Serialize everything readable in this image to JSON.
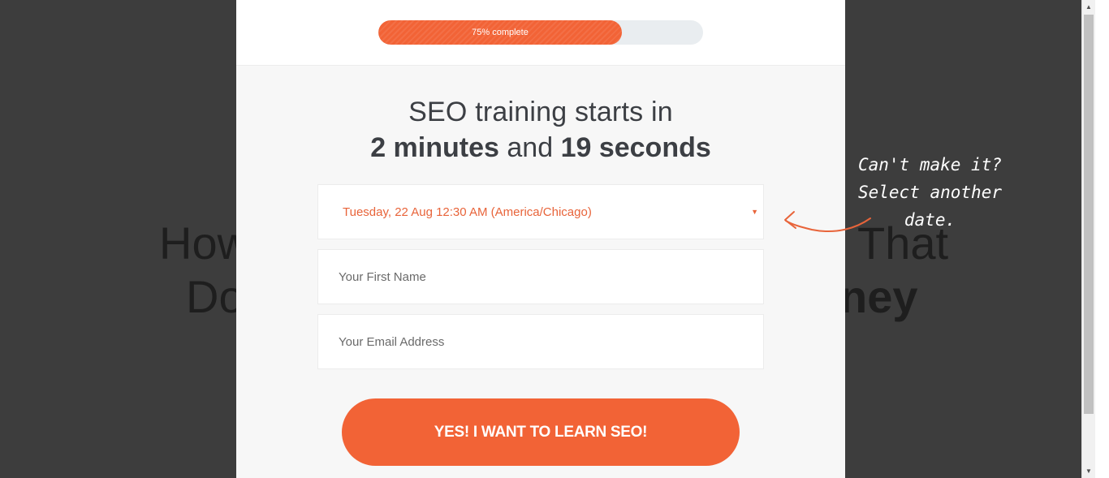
{
  "background": {
    "headline_line1_left": "How",
    "headline_line1_right": "That",
    "headline_line2_left": "Do",
    "headline_line2_right": "ney"
  },
  "progress": {
    "label": "75% complete",
    "value_percent": 75,
    "fill_color": "#f26336"
  },
  "headline": {
    "line1": "SEO training starts in",
    "minutes": "2 minutes",
    "and": "and",
    "seconds": "19 seconds"
  },
  "form": {
    "date_value": "Tuesday, 22 Aug 12:30 AM (America/Chicago)",
    "date_arrow_icon": "caret-down-icon",
    "first_name_placeholder": "Your First Name",
    "email_placeholder": "Your Email Address",
    "submit_label": "YES! I WANT TO LEARN SEO!"
  },
  "annotation": {
    "line1": "Can't make it?",
    "line2": "Select another",
    "line3": "date.",
    "arrow_icon": "curved-arrow-left-icon"
  },
  "scrollbar": {
    "up_icon": "triangle-up-icon",
    "down_icon": "triangle-down-icon"
  },
  "colors": {
    "accent": "#f26336",
    "overlay": "#3d3d3d",
    "modal_bg": "#f7f7f7"
  }
}
